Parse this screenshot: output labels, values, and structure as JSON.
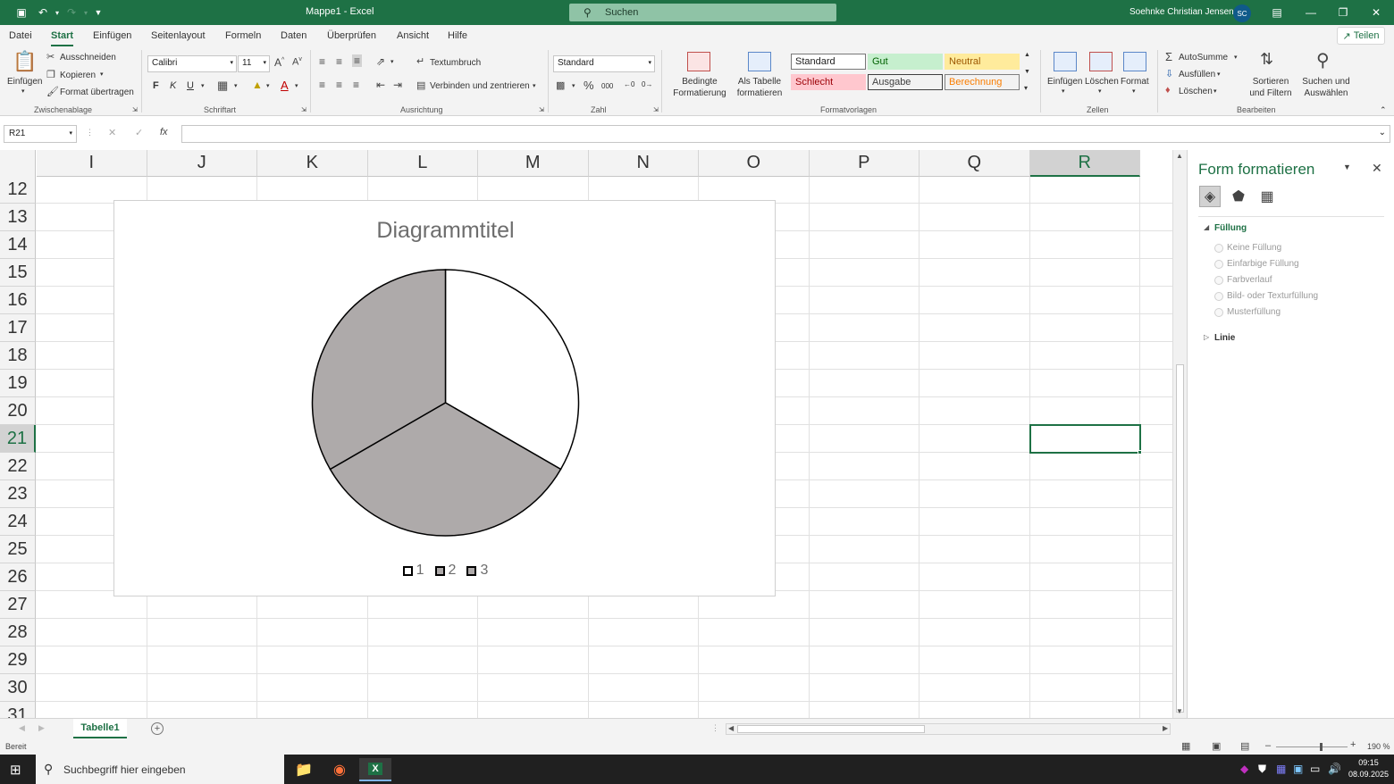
{
  "titlebar": {
    "title": "Mappe1  -  Excel",
    "search_placeholder": "Suchen",
    "user_name": "Soehnke Christian Jensen",
    "user_initials": "SC"
  },
  "menu": {
    "tabs": [
      "Datei",
      "Start",
      "Einfügen",
      "Seitenlayout",
      "Formeln",
      "Daten",
      "Überprüfen",
      "Ansicht",
      "Hilfe"
    ],
    "active": "Start",
    "share_label": "Teilen"
  },
  "ribbon": {
    "clipboard": {
      "paste": "Einfügen",
      "cut": "Ausschneiden",
      "copy": "Kopieren",
      "format_painter": "Format übertragen",
      "group": "Zwischenablage"
    },
    "font": {
      "name": "Calibri",
      "size": "11",
      "bold": "F",
      "italic": "K",
      "underline": "U",
      "group": "Schriftart"
    },
    "alignment": {
      "wrap": "Textumbruch",
      "merge": "Verbinden und zentrieren",
      "group": "Ausrichtung"
    },
    "number": {
      "format": "Standard",
      "group": "Zahl"
    },
    "styles": {
      "conditional": "Bedingte Formatierung",
      "as_table": "Als Tabelle formatieren",
      "cells": [
        "Standard",
        "Gut",
        "Neutral",
        "Schlecht",
        "Ausgabe",
        "Berechnung"
      ],
      "group": "Formatvorlagen"
    },
    "cells": {
      "insert": "Einfügen",
      "delete": "Löschen",
      "format": "Format",
      "group": "Zellen"
    },
    "editing": {
      "autosum": "AutoSumme",
      "fill": "Ausfüllen",
      "clear": "Löschen",
      "sort": "Sortieren und Filtern",
      "find": "Suchen und Auswählen",
      "group": "Bearbeiten"
    }
  },
  "formula_bar": {
    "name_box": "R21",
    "fx": "fx",
    "value": ""
  },
  "grid": {
    "columns": [
      "I",
      "J",
      "K",
      "L",
      "M",
      "N",
      "O",
      "P",
      "Q",
      "R"
    ],
    "rows": [
      "12",
      "13",
      "14",
      "15",
      "16",
      "17",
      "18",
      "19",
      "20",
      "21",
      "22",
      "23",
      "24",
      "25",
      "26",
      "27",
      "28",
      "29",
      "30",
      "31"
    ],
    "selected_column": "R",
    "selected_row": "21"
  },
  "chart_data": {
    "type": "pie",
    "title": "Diagrammtitel",
    "categories": [
      "1",
      "2",
      "3"
    ],
    "values": [
      1,
      1,
      1
    ],
    "colors": [
      "#ffffff",
      "#aeaaaa",
      "#aeaaaa"
    ],
    "legend": "bottom"
  },
  "format_pane": {
    "title": "Form formatieren",
    "fill_section": "Füllung",
    "fill_options": [
      "Keine Füllung",
      "Einfarbige Füllung",
      "Farbverlauf",
      "Bild- oder Texturfüllung",
      "Musterfüllung"
    ],
    "line_section": "Linie"
  },
  "sheets": {
    "tabs": [
      "Tabelle1"
    ],
    "active": "Tabelle1"
  },
  "status": {
    "text": "Bereit",
    "zoom": "190 %"
  },
  "taskbar": {
    "search_placeholder": "Suchbegriff hier eingeben",
    "time": "09:15",
    "date": "08.09.2025"
  },
  "colors": {
    "accent": "#1e7145",
    "chart_gray": "#aeaaaa"
  }
}
